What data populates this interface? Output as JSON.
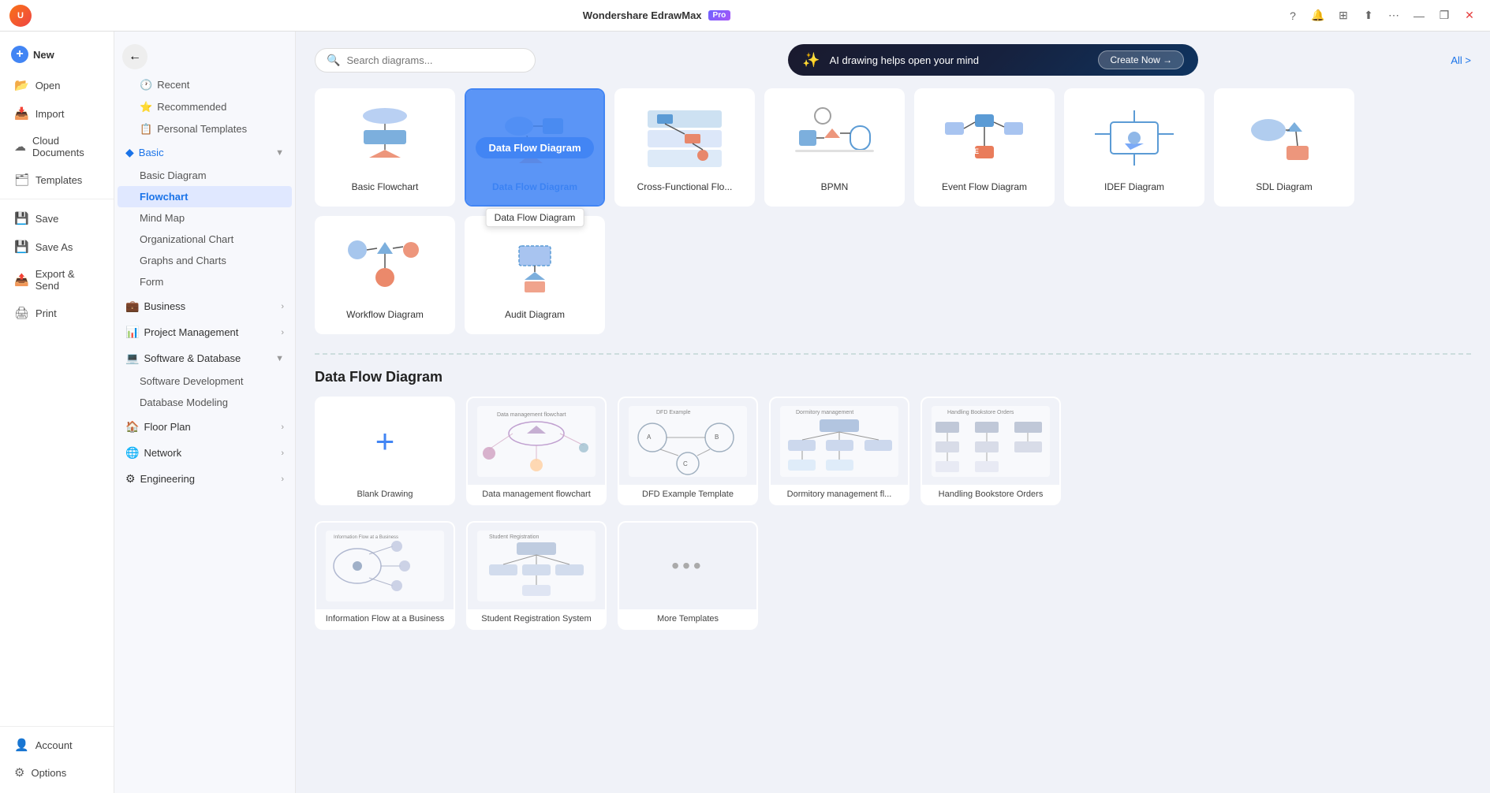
{
  "app": {
    "title": "Wondershare EdrawMax",
    "badge": "Pro"
  },
  "titlebar": {
    "minimize": "—",
    "maximize": "❐",
    "close": "✕",
    "question_icon": "?",
    "bell_icon": "🔔",
    "apps_icon": "⊞",
    "share_icon": "↑",
    "more_icon": "⋯"
  },
  "left_sidebar": {
    "items": [
      {
        "id": "new",
        "label": "New",
        "icon": "📄"
      },
      {
        "id": "open",
        "label": "Open",
        "icon": "📂"
      },
      {
        "id": "import",
        "label": "Import",
        "icon": "📥"
      },
      {
        "id": "cloud",
        "label": "Cloud Documents",
        "icon": "☁"
      },
      {
        "id": "templates",
        "label": "Templates",
        "icon": "🗂"
      },
      {
        "id": "save",
        "label": "Save",
        "icon": "💾"
      },
      {
        "id": "saveas",
        "label": "Save As",
        "icon": "💾"
      },
      {
        "id": "export",
        "label": "Export & Send",
        "icon": "📤"
      },
      {
        "id": "print",
        "label": "Print",
        "icon": "🖨"
      }
    ],
    "bottom_items": [
      {
        "id": "account",
        "label": "Account",
        "icon": "👤"
      },
      {
        "id": "options",
        "label": "Options",
        "icon": "⚙"
      }
    ]
  },
  "nav_sidebar": {
    "recent_label": "Recent",
    "recommended_label": "Recommended",
    "personal_templates_label": "Personal Templates",
    "sections": [
      {
        "id": "basic",
        "label": "Basic",
        "expanded": true,
        "active": true,
        "items": [
          {
            "id": "basic-diagram",
            "label": "Basic Diagram",
            "active": false
          },
          {
            "id": "flowchart",
            "label": "Flowchart",
            "active": true
          },
          {
            "id": "mind-map",
            "label": "Mind Map",
            "active": false
          },
          {
            "id": "org-chart",
            "label": "Organizational Chart",
            "active": false
          },
          {
            "id": "graphs",
            "label": "Graphs and Charts",
            "active": false
          },
          {
            "id": "form",
            "label": "Form",
            "active": false
          }
        ]
      },
      {
        "id": "business",
        "label": "Business",
        "expanded": false,
        "items": []
      },
      {
        "id": "project",
        "label": "Project Management",
        "expanded": false,
        "items": []
      },
      {
        "id": "software",
        "label": "Software & Database",
        "expanded": true,
        "items": [
          {
            "id": "software-dev",
            "label": "Software Development",
            "active": false
          },
          {
            "id": "database-modeling",
            "label": "Database Modeling",
            "active": false
          }
        ]
      },
      {
        "id": "floorplan",
        "label": "Floor Plan",
        "expanded": false,
        "items": []
      },
      {
        "id": "network",
        "label": "Network",
        "expanded": false,
        "items": []
      },
      {
        "id": "engineering",
        "label": "Engineering",
        "expanded": false,
        "items": []
      }
    ]
  },
  "search": {
    "placeholder": "Search diagrams..."
  },
  "ai_banner": {
    "text": "AI drawing helps open your mind",
    "cta": "Create Now →"
  },
  "all_link": "All >",
  "diagram_cards": [
    {
      "id": "basic-flowchart",
      "label": "Basic Flowchart",
      "selected": false
    },
    {
      "id": "data-flow",
      "label": "Data Flow Diagram",
      "selected": true,
      "tooltip": "Data Flow Diagram"
    },
    {
      "id": "cross-functional",
      "label": "Cross-Functional Flo...",
      "selected": false
    },
    {
      "id": "bpmn",
      "label": "BPMN",
      "selected": false
    },
    {
      "id": "event-flow",
      "label": "Event Flow Diagram",
      "selected": false
    },
    {
      "id": "idef",
      "label": "IDEF Diagram",
      "selected": false
    },
    {
      "id": "sdl",
      "label": "SDL Diagram",
      "selected": false
    },
    {
      "id": "workflow",
      "label": "Workflow Diagram",
      "selected": false
    },
    {
      "id": "audit",
      "label": "Audit Diagram",
      "selected": false
    }
  ],
  "section_title": "Data Flow Diagram",
  "template_cards": [
    {
      "id": "blank",
      "label": "Blank Drawing",
      "type": "blank"
    },
    {
      "id": "data-mgmt",
      "label": "Data management flowchart",
      "type": "template"
    },
    {
      "id": "dfd-example",
      "label": "DFD Example Template",
      "type": "template"
    },
    {
      "id": "dormitory",
      "label": "Dormitory management fl...",
      "type": "template"
    },
    {
      "id": "bookstore",
      "label": "Handling Bookstore Orders",
      "type": "template"
    },
    {
      "id": "info-flow",
      "label": "Information Flow at a Business",
      "type": "template"
    },
    {
      "id": "student-reg",
      "label": "Student Registration System",
      "type": "template"
    },
    {
      "id": "more",
      "label": "More Templates",
      "type": "more"
    }
  ],
  "colors": {
    "primary": "#4285f4",
    "accent": "#1a73e8",
    "selected_bg": "#e8f0fe",
    "sidebar_bg": "#f7f8fc",
    "card_bg": "#ffffff",
    "bg": "#f0f2f8"
  }
}
